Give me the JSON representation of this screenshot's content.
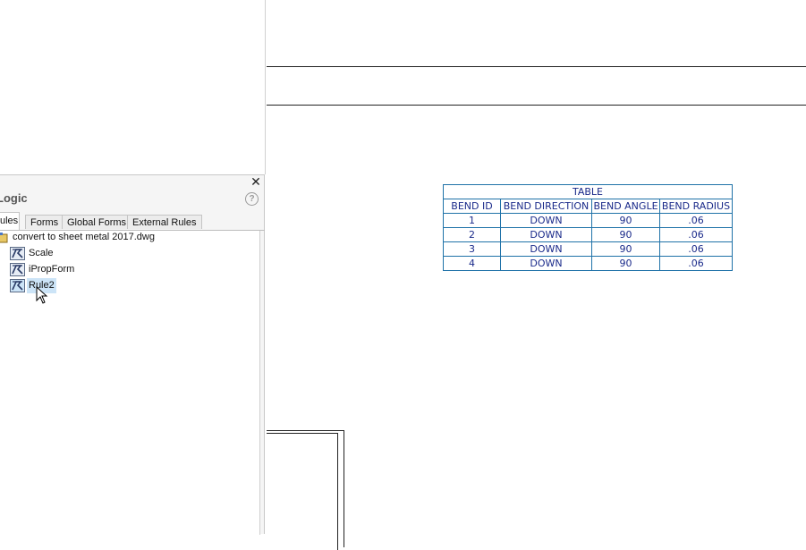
{
  "panel": {
    "title": "Logic",
    "close_glyph": "✕",
    "help_glyph": "?",
    "tabs": [
      {
        "label": "ules",
        "active": true
      },
      {
        "label": "Forms",
        "active": false
      },
      {
        "label": "Global Forms",
        "active": false
      },
      {
        "label": "External Rules",
        "active": false
      }
    ],
    "tree": {
      "document": "convert to sheet metal 2017.dwg",
      "rules": [
        {
          "label": "Scale",
          "icon": "rule-icon"
        },
        {
          "label": "iPropForm",
          "icon": "rule-icon"
        },
        {
          "label": "Rule2",
          "icon": "rule-icon",
          "selected": true
        }
      ]
    }
  },
  "bend_table": {
    "title": "TABLE",
    "headers": [
      "BEND ID",
      "BEND DIRECTION",
      "BEND ANGLE",
      "BEND RADIUS"
    ],
    "rows": [
      [
        "1",
        "DOWN",
        "90",
        ".06"
      ],
      [
        "2",
        "DOWN",
        "90",
        ".06"
      ],
      [
        "3",
        "DOWN",
        "90",
        ".06"
      ],
      [
        "4",
        "DOWN",
        "90",
        ".06"
      ]
    ]
  },
  "colors": {
    "table_border": "#1f72a8",
    "table_text": "#1a2a8a",
    "selection": "#cce4f7"
  }
}
